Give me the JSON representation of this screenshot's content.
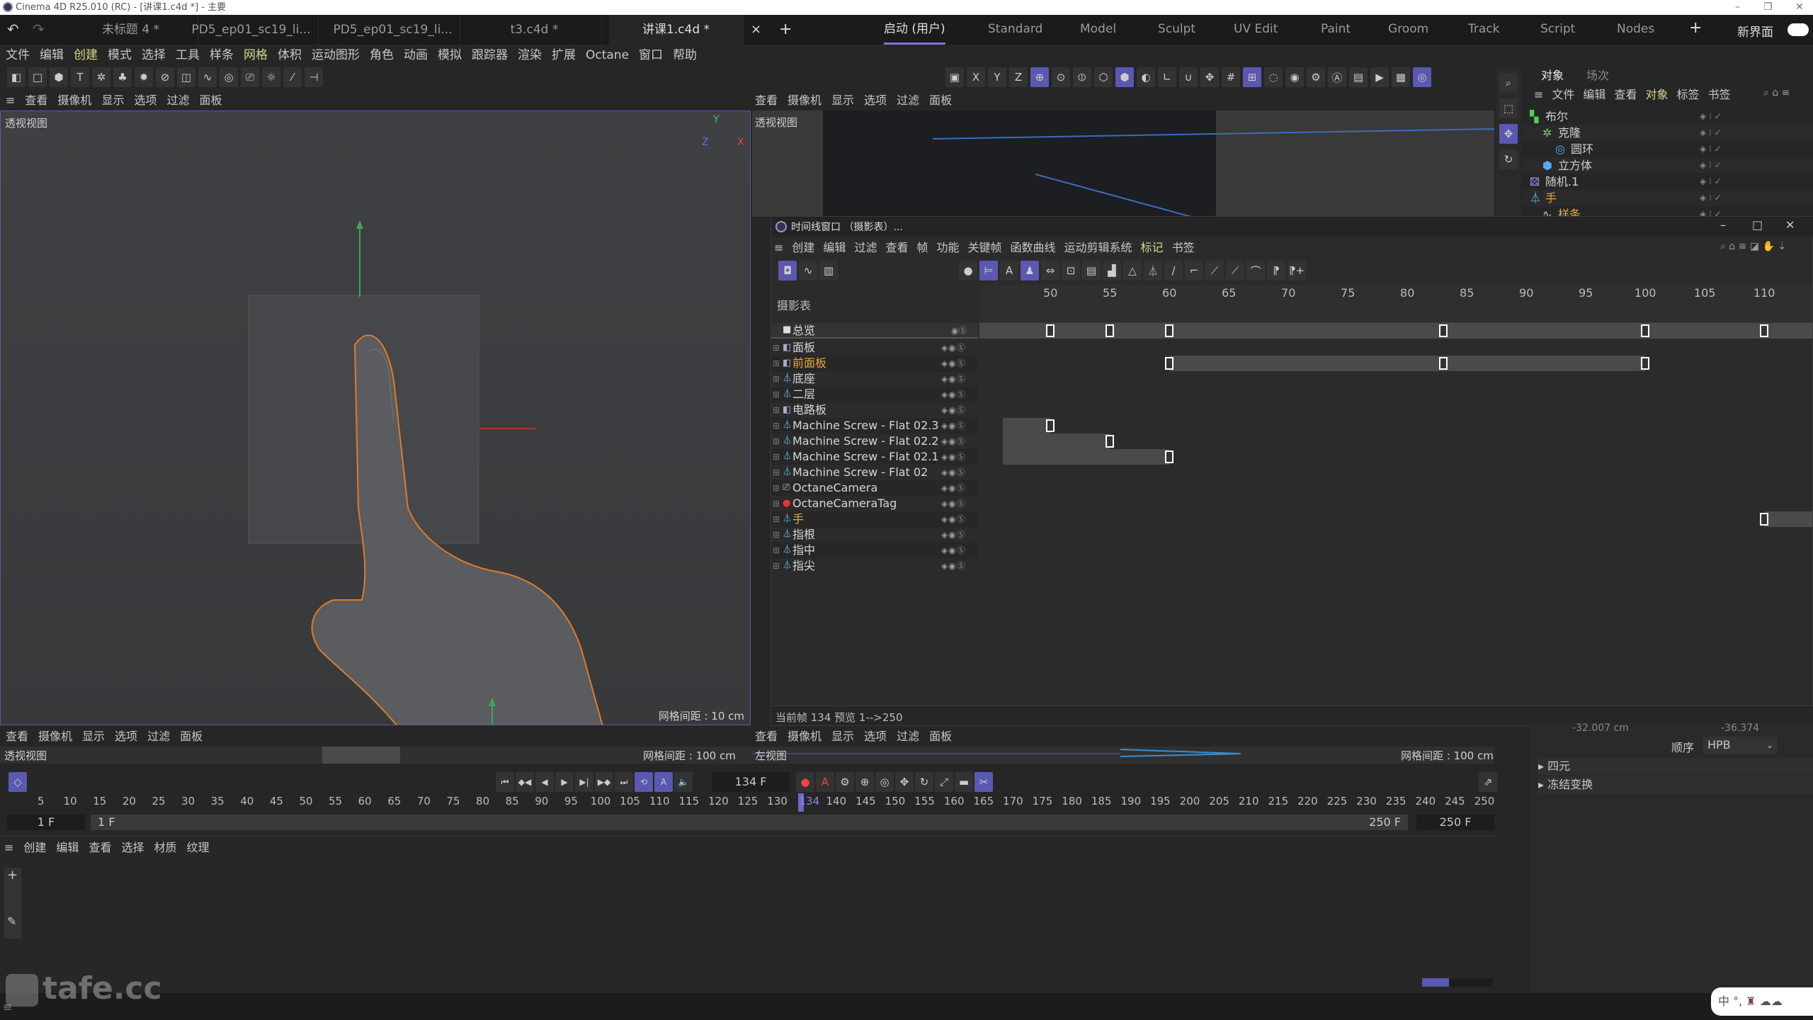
{
  "window": {
    "title": "Cinema 4D R25.010 (RC) - [讲课1.c4d *] - 主要"
  },
  "doc_tabs": [
    {
      "label": "未标题 4 *"
    },
    {
      "label": "PD5_ep01_sc19_li..."
    },
    {
      "label": "PD5_ep01_sc19_li..."
    },
    {
      "label": "t3.c4d *"
    },
    {
      "label": "讲课1.c4d *",
      "active": true
    }
  ],
  "layout_tabs": [
    {
      "label": "启动 (用户)",
      "active": true
    },
    {
      "label": "Standard"
    },
    {
      "label": "Model"
    },
    {
      "label": "Sculpt"
    },
    {
      "label": "UV Edit"
    },
    {
      "label": "Paint"
    },
    {
      "label": "Groom"
    },
    {
      "label": "Track"
    },
    {
      "label": "Script"
    },
    {
      "label": "Nodes"
    }
  ],
  "new_ui_label": "新界面",
  "menu": [
    "文件",
    "编辑",
    "创建",
    "模式",
    "选择",
    "工具",
    "样条",
    "网格",
    "体积",
    "运动图形",
    "角色",
    "动画",
    "模拟",
    "跟踪器",
    "渲染",
    "扩展",
    "Octane",
    "窗口",
    "帮助"
  ],
  "viewport_menu": [
    "查看",
    "摄像机",
    "显示",
    "选项",
    "过滤",
    "面板"
  ],
  "viewports": {
    "top_left": {
      "label": "透视视图",
      "grid": "网格间距 : 10 cm"
    },
    "top_right": {
      "label": "透视视图"
    },
    "bottom_left": {
      "label": "透视视图",
      "grid": "网格间距 : 100 cm"
    },
    "bottom_right": {
      "label": "左视图",
      "grid": "网格间距 : 100 cm"
    }
  },
  "object_manager": {
    "tabs": [
      "对象",
      "场次"
    ],
    "menu": [
      "文件",
      "编辑",
      "查看",
      "对象",
      "标签",
      "书签"
    ],
    "items": [
      {
        "name": "布尔",
        "icon": "boole-icon",
        "indent": 0,
        "color": "#d0d0d0"
      },
      {
        "name": "克隆",
        "icon": "cloner-icon",
        "indent": 1,
        "color": "#d0d0d0"
      },
      {
        "name": "圆环",
        "icon": "torus-icon",
        "indent": 2,
        "color": "#d0d0d0"
      },
      {
        "name": "立方体",
        "icon": "cube-icon",
        "indent": 1,
        "color": "#d0d0d0"
      },
      {
        "name": "随机.1",
        "icon": "random-icon",
        "indent": 0,
        "color": "#d0d0d0"
      },
      {
        "name": "手",
        "icon": "joint-icon",
        "indent": 0,
        "color": "#e8a640"
      },
      {
        "name": "样条",
        "icon": "spline-icon",
        "indent": 1,
        "color": "#e8a640"
      }
    ]
  },
  "timeline": {
    "title": "时间线窗口 （摄影表）...",
    "menu": [
      "创建",
      "编辑",
      "过滤",
      "查看",
      "帧",
      "功能",
      "关键帧",
      "函数曲线",
      "运动剪辑系统",
      "标记",
      "书签"
    ],
    "panel_label": "摄影表",
    "summary": "总览",
    "ruler": [
      50,
      55,
      60,
      65,
      70,
      75,
      80,
      85,
      90,
      95,
      100,
      105,
      110
    ],
    "tracks": [
      {
        "name": "面板",
        "icon": "plane-icon",
        "keys": []
      },
      {
        "name": "前面板",
        "icon": "plane-icon",
        "highlight": true,
        "keys": [
          60,
          83,
          100
        ],
        "bar": [
          60,
          100
        ]
      },
      {
        "name": "底座",
        "icon": "joint-icon",
        "keys": []
      },
      {
        "name": "二层",
        "icon": "joint-icon",
        "keys": []
      },
      {
        "name": "电路板",
        "icon": "plane-icon",
        "keys": []
      },
      {
        "name": "Machine Screw - Flat 02.3",
        "icon": "joint-icon",
        "keys": [
          50
        ],
        "bar": [
          46,
          50
        ]
      },
      {
        "name": "Machine Screw - Flat 02.2",
        "icon": "joint-icon",
        "keys": [
          55
        ],
        "bar": [
          46,
          55
        ]
      },
      {
        "name": "Machine Screw - Flat 02.1",
        "icon": "joint-icon",
        "keys": [
          60
        ],
        "bar": [
          46,
          60
        ]
      },
      {
        "name": "Machine Screw - Flat 02",
        "icon": "joint-icon",
        "keys": []
      },
      {
        "name": "OctaneCamera",
        "icon": "camera-icon",
        "keys": []
      },
      {
        "name": "OctaneCameraTag",
        "icon": "camera-tag-icon",
        "keys": []
      },
      {
        "name": "手",
        "icon": "joint-icon",
        "highlight": true,
        "keys": [
          110
        ],
        "bar": [
          110,
          115
        ]
      },
      {
        "name": "指根",
        "icon": "joint-icon",
        "keys": []
      },
      {
        "name": "指中",
        "icon": "joint-icon",
        "keys": []
      },
      {
        "name": "指尖",
        "icon": "joint-icon",
        "keys": []
      }
    ],
    "summary_keys": [
      50,
      55,
      60,
      83,
      100,
      110
    ],
    "status": "当前帧  134  预览  1-->250"
  },
  "transport": {
    "current_frame": "134 F",
    "start": "1 F",
    "start2": "1 F",
    "end": "250 F",
    "end2": "250 F",
    "current": 134,
    "min": 0,
    "max": 250
  },
  "material_menu": [
    "创建",
    "编辑",
    "查看",
    "选择",
    "材质",
    "纹理"
  ],
  "attributes": {
    "coord_partial": "-32.007 cm",
    "coord_partial2": "-36.374",
    "order_label": "顺序",
    "order_value": "HPB",
    "sections": [
      "四元",
      "冻结变换"
    ]
  },
  "watermark": "tafe.cc",
  "ime": {
    "label": "中"
  },
  "colors": {
    "accent": "#5a58b0",
    "key_orange": "#e8a640",
    "selection": "#e07a2a"
  }
}
